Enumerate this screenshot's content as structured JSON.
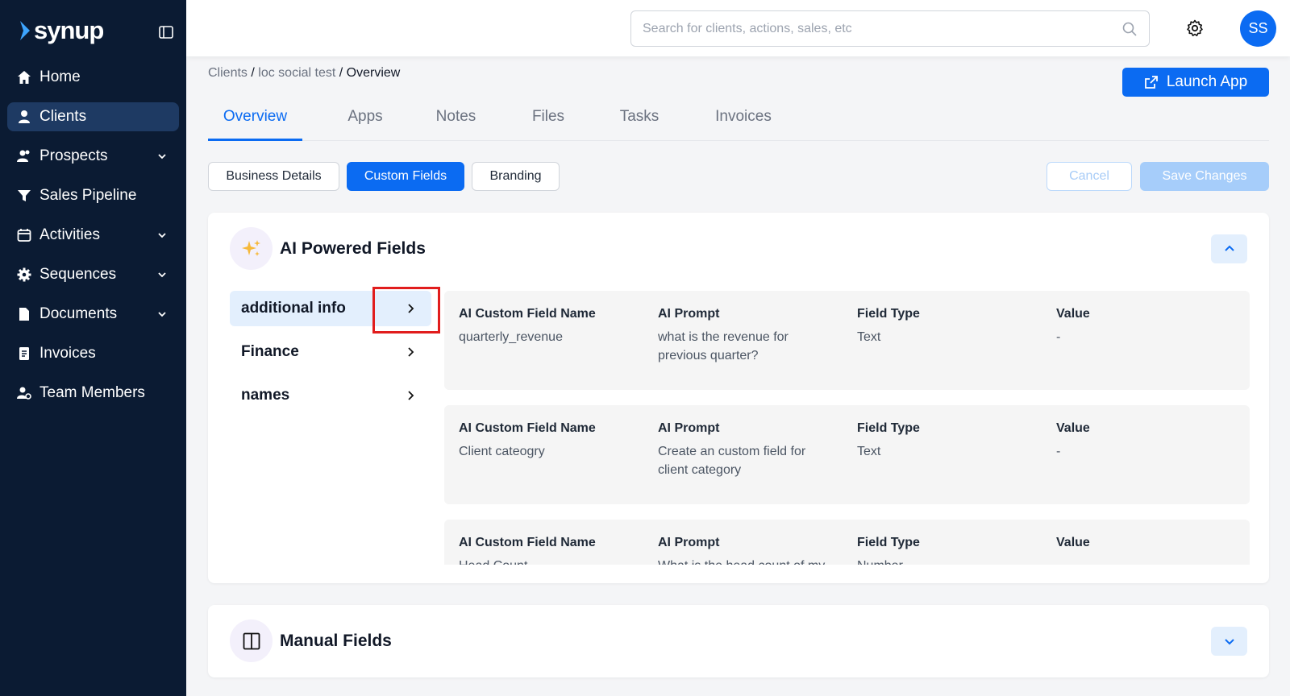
{
  "brand": {
    "name": "synup"
  },
  "sidebar": {
    "items": [
      {
        "label": "Home",
        "icon": "home-icon"
      },
      {
        "label": "Clients",
        "icon": "user-icon"
      },
      {
        "label": "Prospects",
        "icon": "users-icon"
      },
      {
        "label": "Sales Pipeline",
        "icon": "funnel-icon"
      },
      {
        "label": "Activities",
        "icon": "calendar-icon"
      },
      {
        "label": "Sequences",
        "icon": "gear-icon"
      },
      {
        "label": "Documents",
        "icon": "document-icon"
      },
      {
        "label": "Invoices",
        "icon": "invoice-icon"
      },
      {
        "label": "Team Members",
        "icon": "team-icon"
      }
    ]
  },
  "search": {
    "placeholder": "Search for clients, actions, sales, etc",
    "value": ""
  },
  "user": {
    "initials": "SS"
  },
  "breadcrumb": {
    "root": "Clients",
    "client": "loc social test",
    "current": "Overview",
    "sep": "/"
  },
  "header": {
    "launch_label": "Launch App"
  },
  "tabs": [
    {
      "label": "Overview"
    },
    {
      "label": "Apps"
    },
    {
      "label": "Notes"
    },
    {
      "label": "Files"
    },
    {
      "label": "Tasks"
    },
    {
      "label": "Invoices"
    }
  ],
  "subtabs": [
    {
      "label": "Business Details"
    },
    {
      "label": "Custom Fields"
    },
    {
      "label": "Branding"
    }
  ],
  "actions": {
    "cancel": "Cancel",
    "save": "Save Changes"
  },
  "ai_section": {
    "title": "AI Powered Fields",
    "groups": [
      {
        "label": "additional info"
      },
      {
        "label": "Finance"
      },
      {
        "label": "names"
      }
    ],
    "headers": {
      "name": "AI Custom Field Name",
      "prompt": "AI Prompt",
      "type": "Field Type",
      "value": "Value"
    },
    "fields": [
      {
        "name": "quarterly_revenue",
        "prompt": "what is the revenue for previous quarter?",
        "type": "Text",
        "value": "-"
      },
      {
        "name": "Client cateogry",
        "prompt": "Create an custom field for client category",
        "type": "Text",
        "value": "-"
      },
      {
        "name": "Head Count",
        "prompt": "What is the head count of my",
        "type": "Number",
        "value": "-"
      }
    ]
  },
  "manual_section": {
    "title": "Manual Fields"
  },
  "colors": {
    "sidebar_bg": "#0b1b33",
    "accent": "#0b6bf2",
    "highlight": "#e11d1d"
  }
}
